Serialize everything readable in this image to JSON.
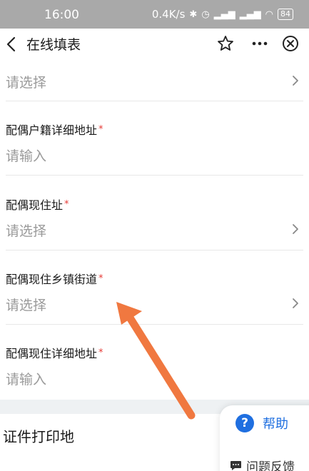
{
  "status": {
    "time": "16:00",
    "network_speed": "0.4K/s",
    "icons": [
      "bluetooth-icon",
      "alarm-icon",
      "signal-icon",
      "signal-icon",
      "wifi-icon"
    ],
    "battery": "84"
  },
  "nav": {
    "title": "在线填表",
    "icons": [
      "back-arrow-icon",
      "star-icon",
      "more-icon",
      "close-icon"
    ]
  },
  "fields": [
    {
      "label": "",
      "value": "请选择",
      "required": false,
      "type": "select"
    },
    {
      "label": "配偶户籍详细地址",
      "value": "请输入",
      "required": true,
      "type": "input"
    },
    {
      "label": "配偶现住址",
      "value": "请选择",
      "required": true,
      "type": "select"
    },
    {
      "label": "配偶现住乡镇街道",
      "value": "请选择",
      "required": true,
      "type": "select"
    },
    {
      "label": "配偶现住详细地址",
      "value": "请输入",
      "required": true,
      "type": "input"
    }
  ],
  "required_mark": "*",
  "section": {
    "title": "证件打印地"
  },
  "help": {
    "icon_text": "?",
    "label": "帮助",
    "feedback": "问题反馈"
  },
  "colors": {
    "accent": "#1f6fe0",
    "required": "#e53935",
    "placeholder": "#9a9a9a",
    "annotation_arrow": "#f07840"
  }
}
